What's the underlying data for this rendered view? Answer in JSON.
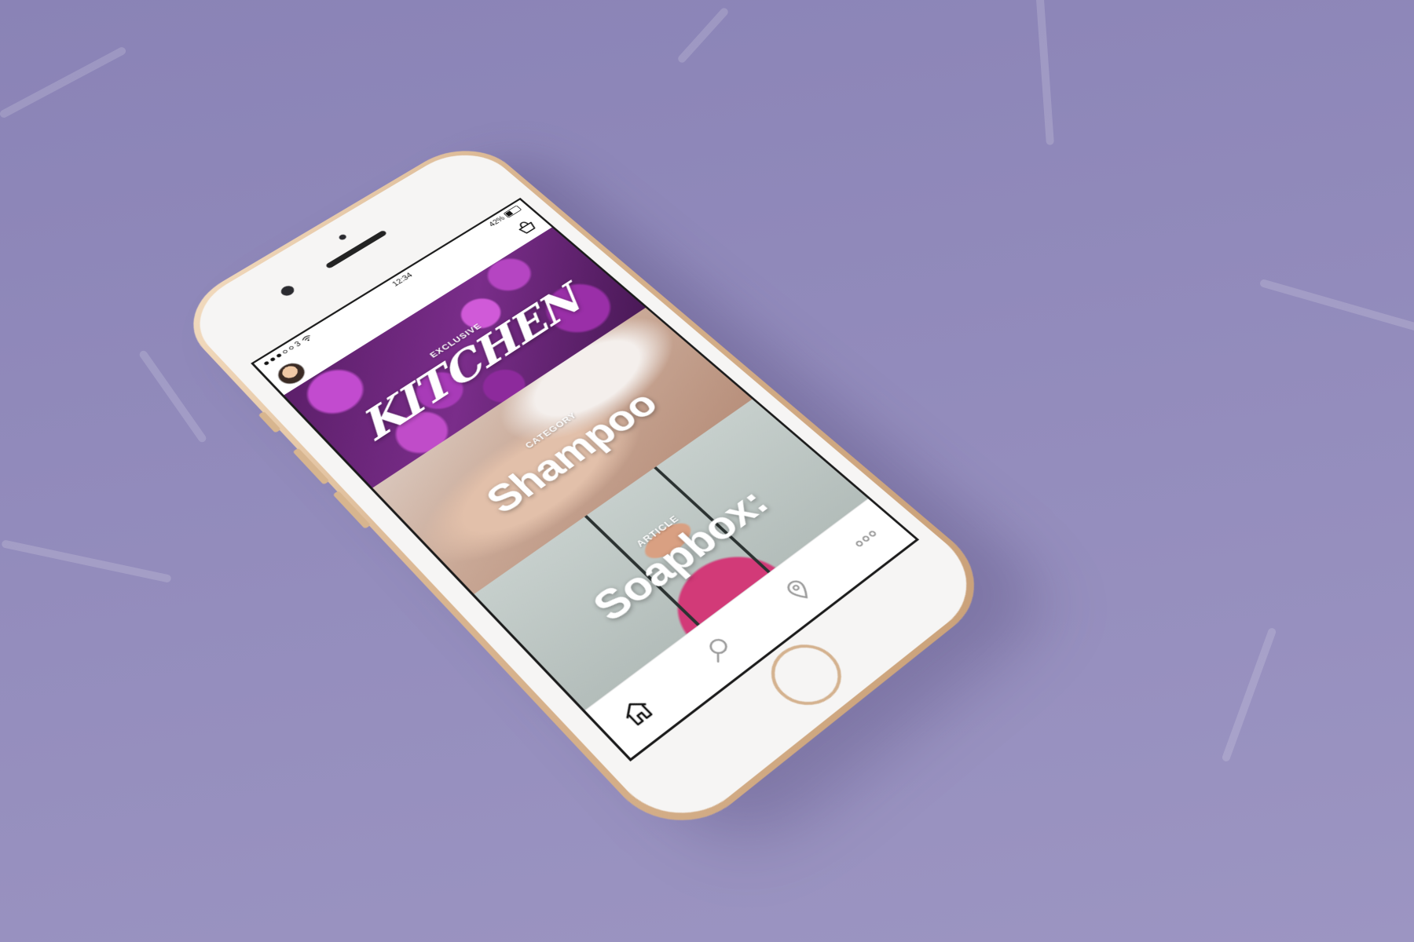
{
  "status_bar": {
    "carrier": "3",
    "time": "12:34",
    "battery": "42%",
    "battery_level": 0.42
  },
  "header": {
    "avatar_icon": "user-avatar",
    "basket_icon": "basket-icon"
  },
  "feed": {
    "cards": [
      {
        "label": "EXCLUSIVE",
        "title": "KITCHEN"
      },
      {
        "label": "CATEGORY",
        "title": "Shampoo"
      },
      {
        "label": "ARTICLE",
        "title": "Soapbox:"
      }
    ]
  },
  "tab_bar": {
    "icons": [
      "home-icon",
      "search-icon",
      "map-pin-icon",
      "more-icon"
    ]
  },
  "colors": {
    "background": "#8a83b6",
    "phone_gold": "#d9b590",
    "text_on_image": "#ffffff"
  }
}
